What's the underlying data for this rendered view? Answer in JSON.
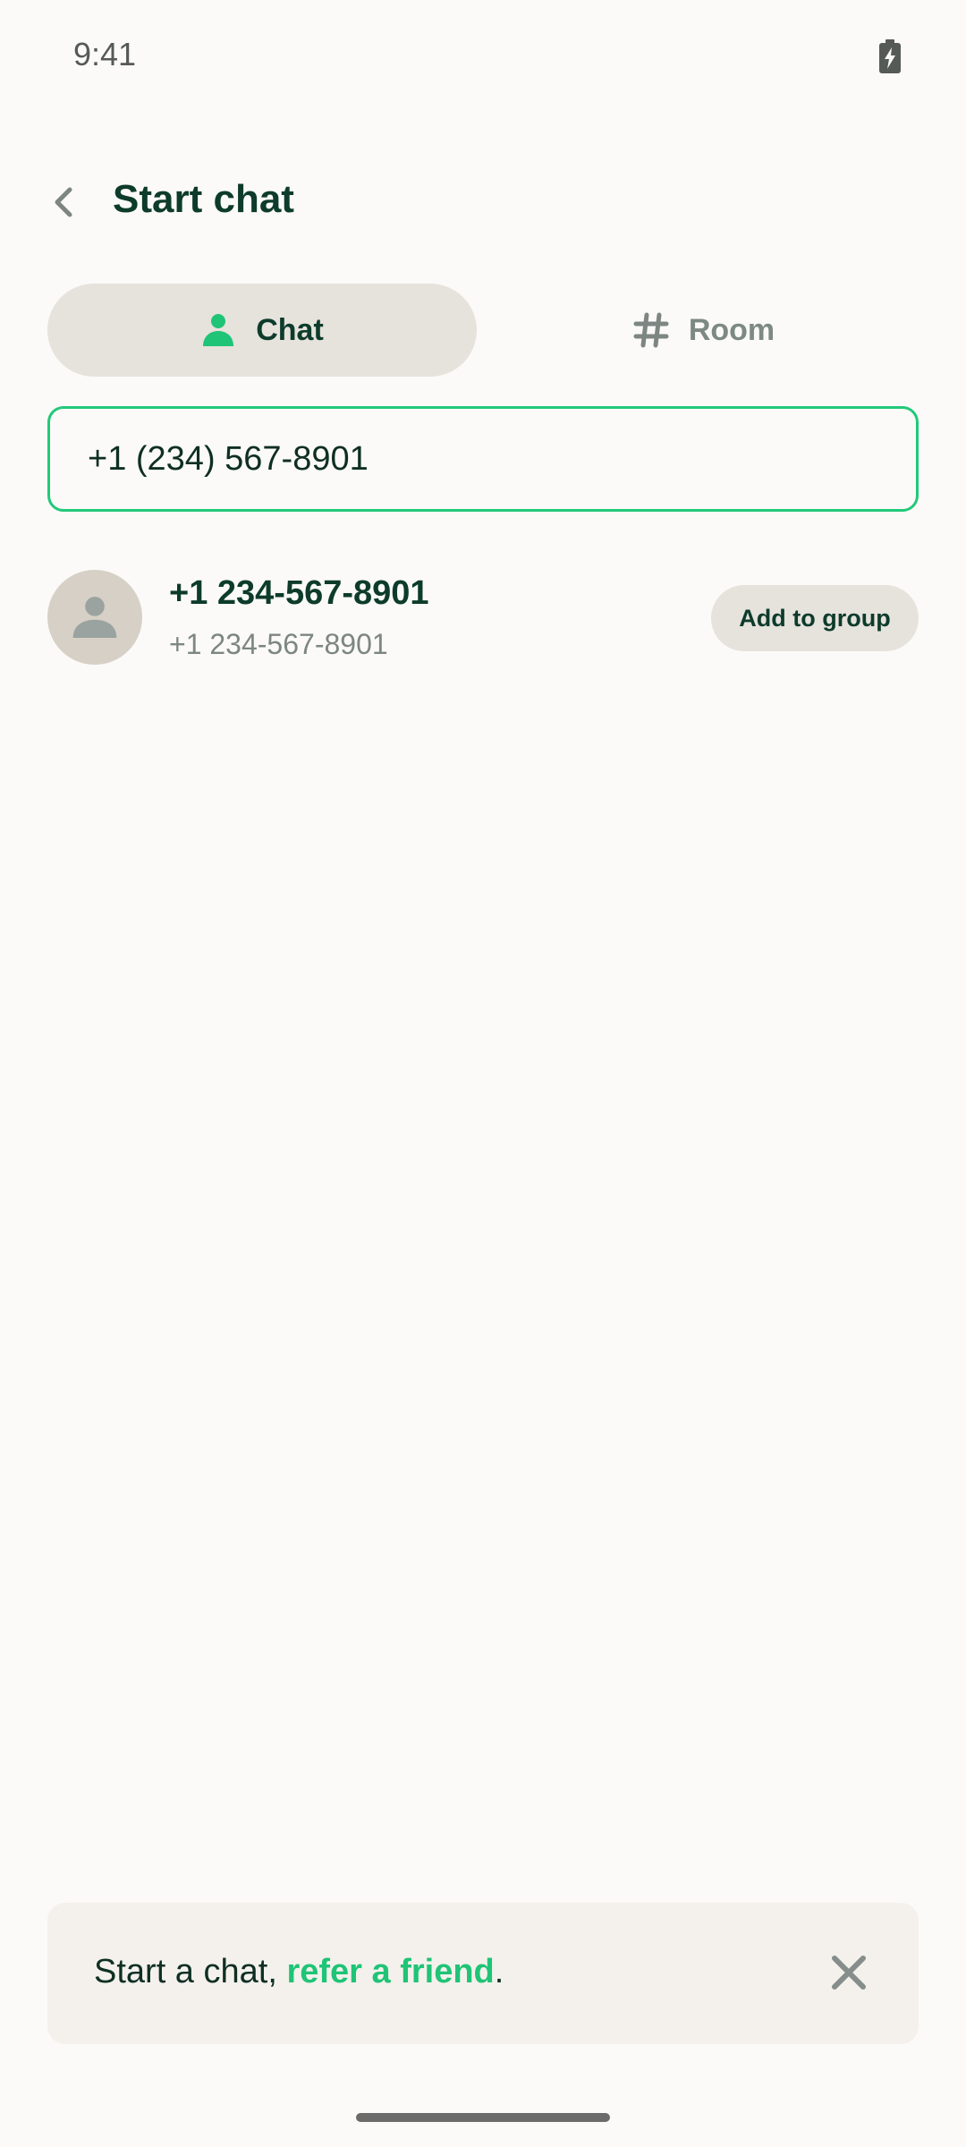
{
  "status_bar": {
    "time": "9:41",
    "battery_icon": "battery-charging-icon"
  },
  "header": {
    "title": "Start chat",
    "back_icon": "chevron-left-icon"
  },
  "tabs": [
    {
      "label": "Chat",
      "icon": "person-icon",
      "active": true
    },
    {
      "label": "Room",
      "icon": "hash-icon",
      "active": false
    }
  ],
  "search": {
    "value": "+1 (234) 567-8901"
  },
  "result": {
    "name": "+1 234-567-8901",
    "subtitle": "+1 234-567-8901",
    "action_label": "Add to group",
    "avatar_icon": "person-icon"
  },
  "referral": {
    "prefix": "Start a chat, ",
    "link": "refer a friend",
    "suffix": ".",
    "close_icon": "close-icon"
  },
  "colors": {
    "accent": "#22c97a",
    "background": "#fbfaf8",
    "text_primary": "#0d3b2c",
    "text_secondary": "#7d8683",
    "chip_bg": "#e6e2dc"
  }
}
